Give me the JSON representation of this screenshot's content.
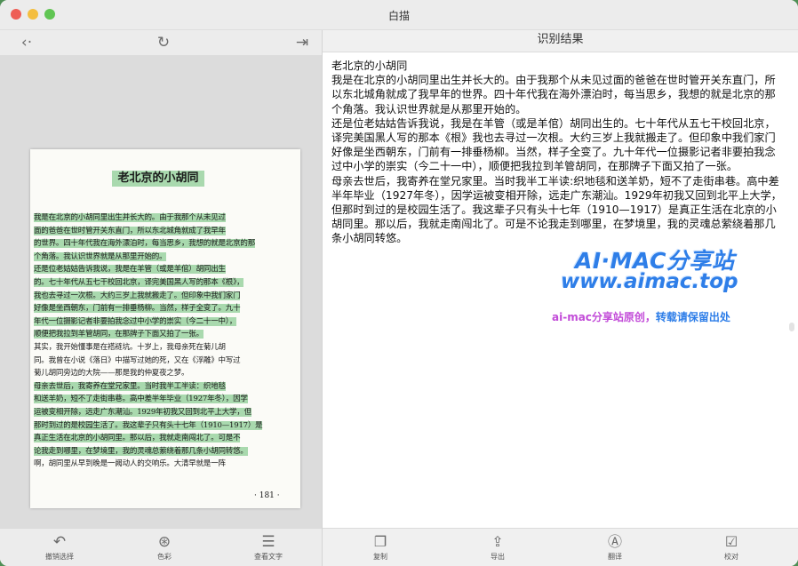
{
  "window": {
    "title": "白描"
  },
  "left_toolbar": {
    "back_icon": "‹·",
    "refresh_icon": "↻",
    "export_icon": "⇥"
  },
  "document": {
    "title": "老北京的小胡同",
    "lines": [
      "我是在北京的小胡同里出生并长大的。由于我那个从未见过",
      "面的爸爸在世时管开关东直门，所以东北城角就成了我早年",
      "的世界。四十年代我在海外漂泊时，每当思乡，我想的就是北京的那",
      "个角落。我认识世界就是从那里开始的。",
      "还是位老姑姑告诉我说，我是在羊管（或是羊倌）胡同出生",
      "的。七十年代从五七干校回北京，译完美国黑人写的那本《根》，",
      "我也去寻过一次根。大约三岁上我就搬走了。但印象中我们家门",
      "好像是坐西朝东，门前有一排垂杨柳。当然，样子全变了。九十",
      "年代一位摄影记者非要拍我念过中小学的崇实（今二十一中），",
      "顺便把我拉到羊管胡同，在那牌子下面又拍了一张。",
      "其实，我开始懂事是在褡裢坑。十岁上，我母亲死在菊儿胡",
      "同。我曾在小说《落日》中描写过她的死，又在《浮雕》中写过",
      "菊儿胡同旁边的大院——那是我的仲夏夜之梦。",
      "母亲去世后，我寄养在堂兄家里。当时我半工半读：织地毯",
      "和送羊奶，短不了走街串巷。高中差半年毕业（1927年冬），因学",
      "运被变相开除，远走广东潮汕。1929年初我又回到北平上大学，但",
      "那时到过的是校园生活了。我这辈子只有头十七年（1910—1917）是",
      "真正生活在北京的小胡同里。那以后，我就走南闯北了。可是不",
      "论我走到哪里，在梦境里，我的灵魂总萦绕着那几条小胡同转悠。",
      "啊，胡同里从早到晚是一阙动人的交响乐。大清早就是一阵"
    ],
    "page_number": "· 181 ·"
  },
  "left_bottom": [
    {
      "icon": "↶",
      "label": "撤销选择"
    },
    {
      "icon": "⊛",
      "label": "色彩"
    },
    {
      "icon": "☰",
      "label": "查看文字"
    }
  ],
  "result_panel": {
    "header": "识别结果",
    "paragraphs": [
      "老北京的小胡同",
      "我是在北京的小胡同里出生并长大的。由于我那个从未见过面的爸爸在世时管开关东直门，所以东北城角就成了我早年的世界。四十年代我在海外漂泊时，每当思乡，我想的就是北京的那个角落。我认识世界就是从那里开始的。",
      "还是位老姑姑告诉我说，我是在羊管（或是羊倌）胡同出生的。七十年代从五七干校回北京，译完美国黑人写的那本《根》我也去寻过一次根。大约三岁上我就搬走了。但印象中我们家门好像是坐西朝东，门前有一排垂杨柳。当然，样子全变了。九十年代一位摄影记者非要拍我念过中小学的崇实（今二十一中），顺便把我拉到羊管胡同，在那牌子下面又拍了一张。",
      "母亲去世后，我寄养在堂兄家里。当时我半工半读:织地毯和送羊奶，短不了走街串巷。高中差半年毕业（1927年冬），因学运被变相开除，远走广东潮汕。1929年初我又回到北平上大学，但那时到过的是校园生活了。我这辈子只有头十七年（1910—1917）是真正生活在北京的小胡同里。那以后，我就走南闯北了。可是不论我走到哪里，在梦境里，我的灵魂总萦绕着那几条小胡同转悠。"
    ],
    "watermark_line1": "AI·MAC分享站",
    "watermark_line2": "www.aimac.top",
    "watermark_line3_a": "ai-mac分享站原创，",
    "watermark_line3_b": "转载请保留出处"
  },
  "right_bottom": [
    {
      "icon": "❐",
      "label": "复制"
    },
    {
      "icon": "⇪",
      "label": "导出"
    },
    {
      "icon": "Ⓐ",
      "label": "翻译"
    },
    {
      "icon": "☑",
      "label": "校对"
    }
  ],
  "colors": {
    "highlight": "#a9d9ae",
    "accent": "#2e7ee8",
    "background": "#4f8f55"
  }
}
